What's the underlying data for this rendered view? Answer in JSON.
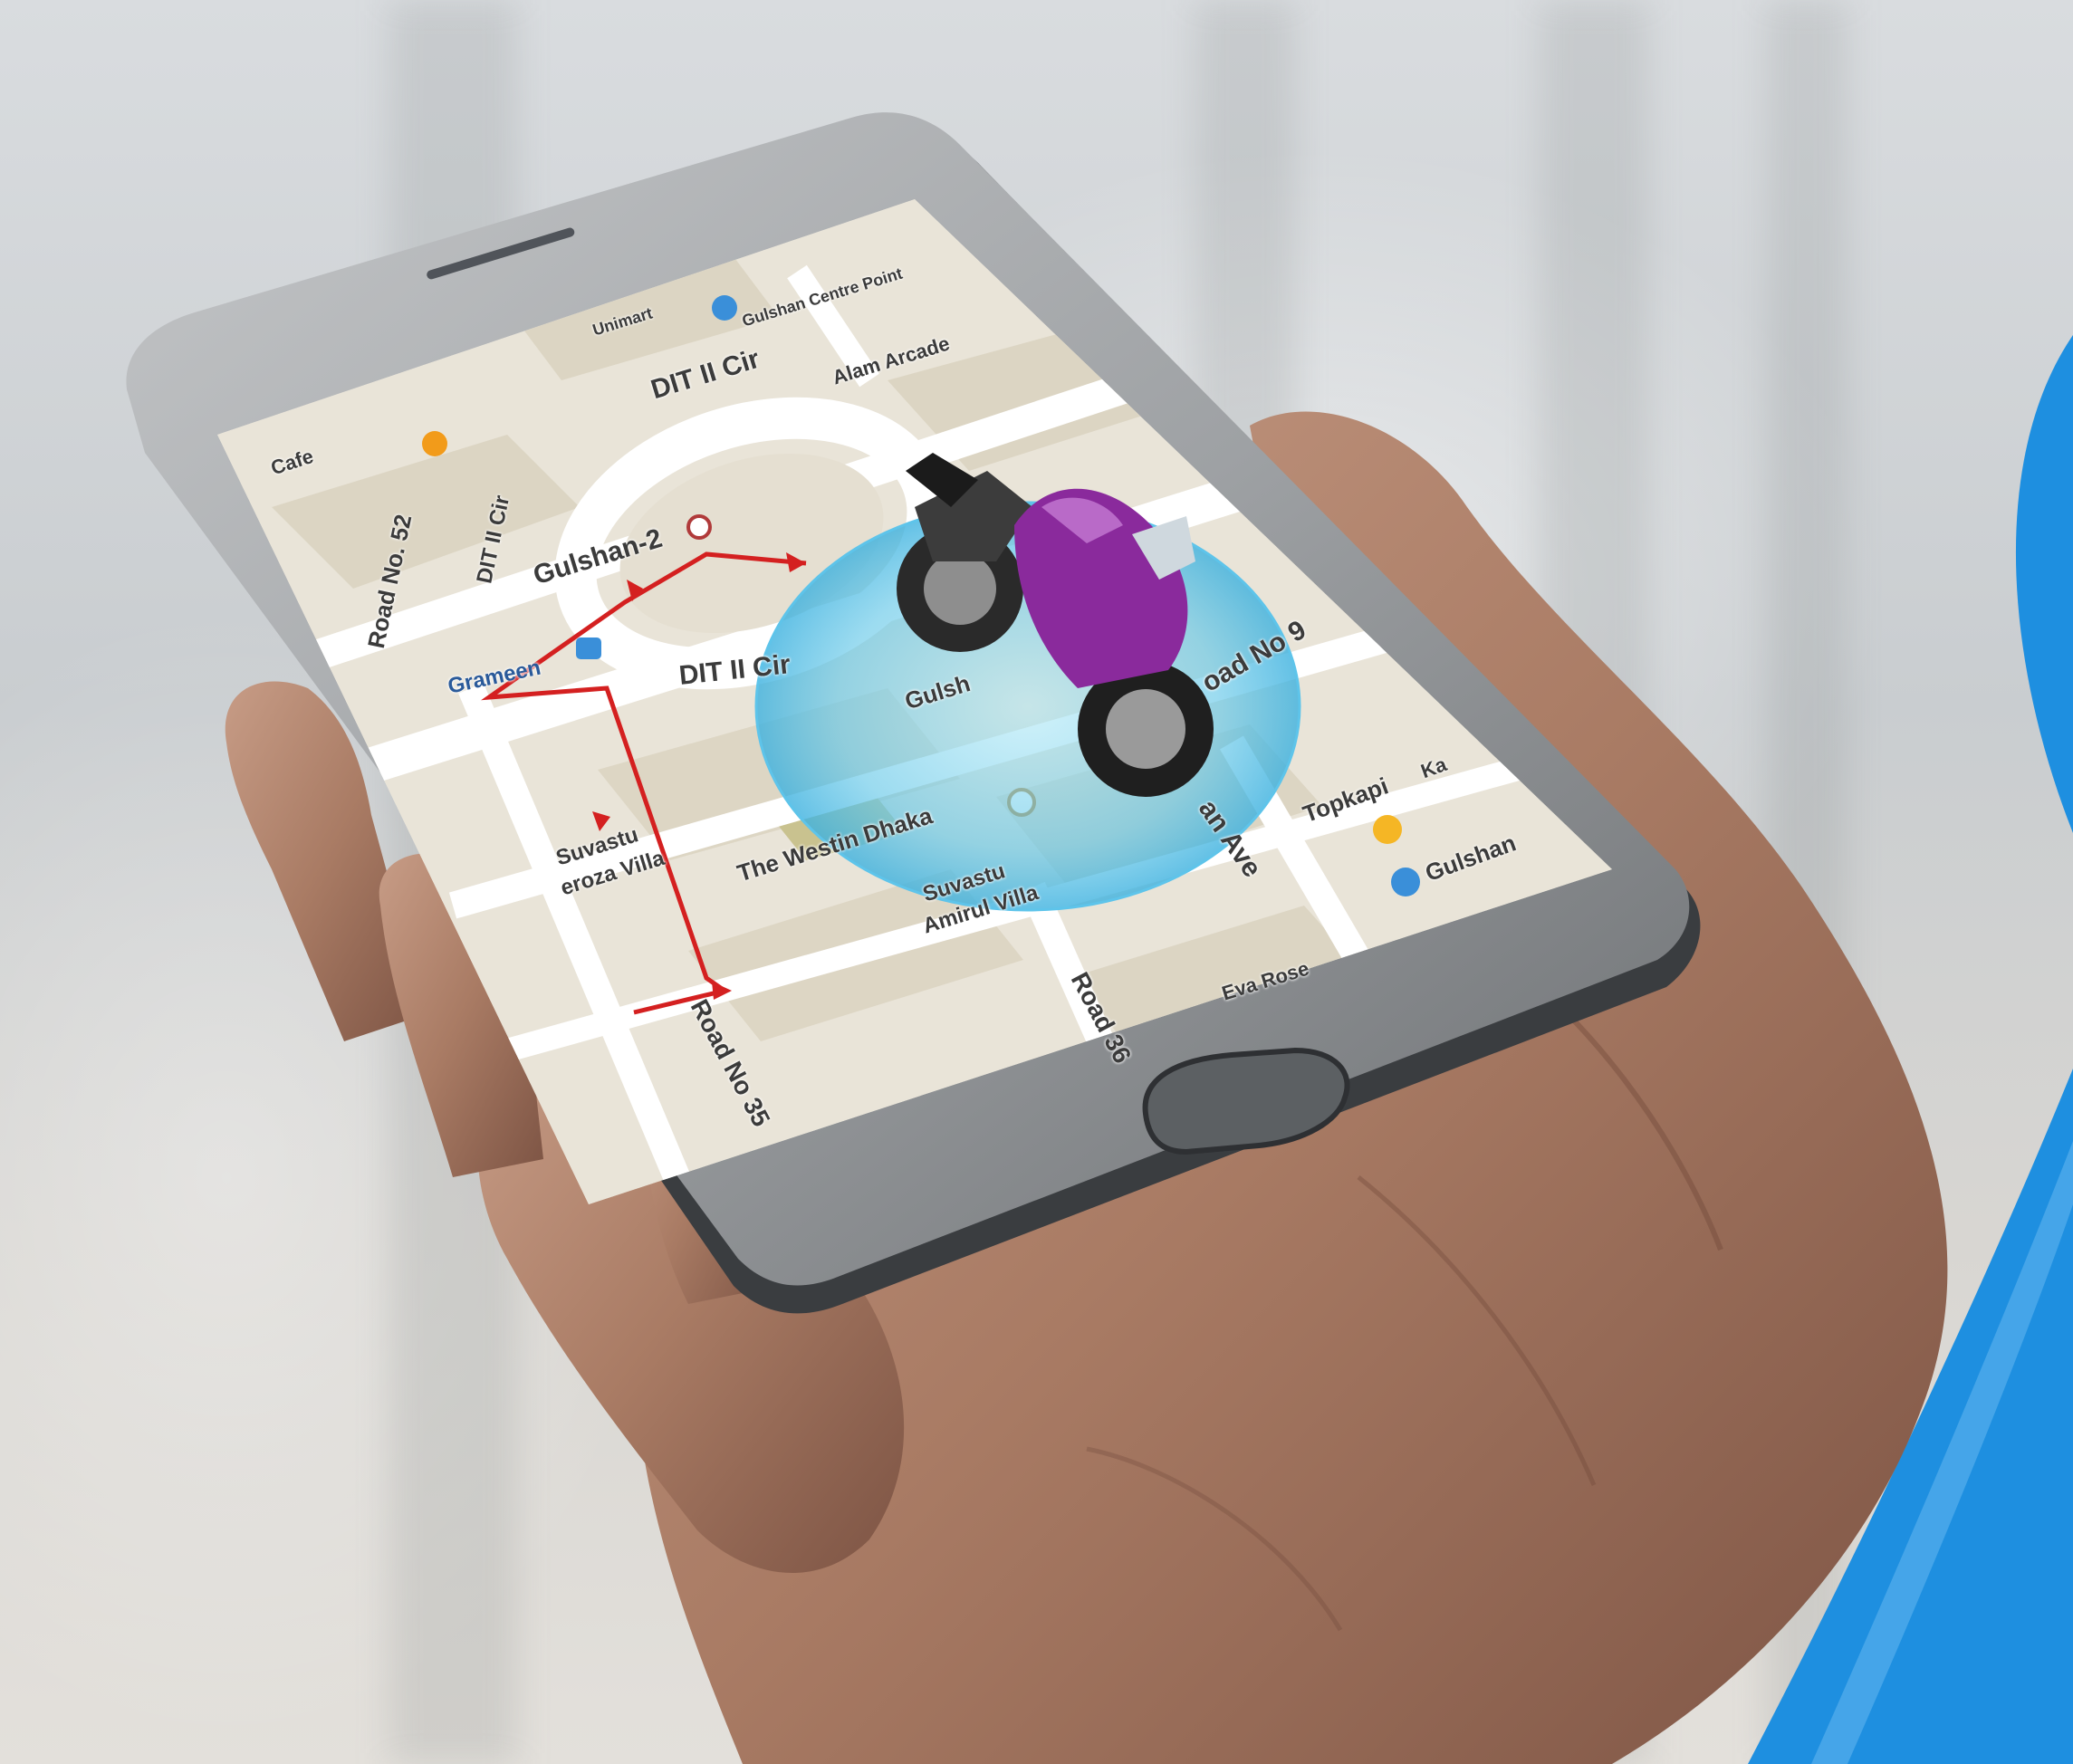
{
  "photo": {
    "subject": "hand holding smartphone showing map with motorcycle tracker",
    "accent_color": "#1e8fe0",
    "route_color": "#d42020",
    "vehicle_color": "#8a2a9c",
    "icons": [
      "motorcycle-icon",
      "location-circle-icon",
      "route-arrow-icon",
      "home-button-icon"
    ]
  },
  "map": {
    "labels": {
      "cafe": "Cafe",
      "dit_top": "DIT II Cir",
      "alam_arcade": "Alam Arcade",
      "gulshan_centre": "Gulshan Centre Point",
      "unimart": "Unimart",
      "road52": "Road No. 52",
      "dit_left": "DIT II Cir",
      "gulshan2": "Gulshan-2",
      "grameen": "Grameen",
      "dit_bottom": "DIT II Cir",
      "gulshan_mid": "Gulsh",
      "road_no_right": "oad No 9",
      "suvastu_left": "Suvastu",
      "suvastu_left2": "eroza Villa",
      "westin": "The Westin Dhaka",
      "suvastu_mid": "Suvastu",
      "amirul": "Amirul Villa",
      "road35": "Road No 35",
      "road36": "Road 36",
      "eva_rose": "Eva Rose",
      "topkapi": "Topkapi",
      "gulshan_right": "Gulshan",
      "avenue": "an Ave",
      "ka": "Ka"
    }
  }
}
